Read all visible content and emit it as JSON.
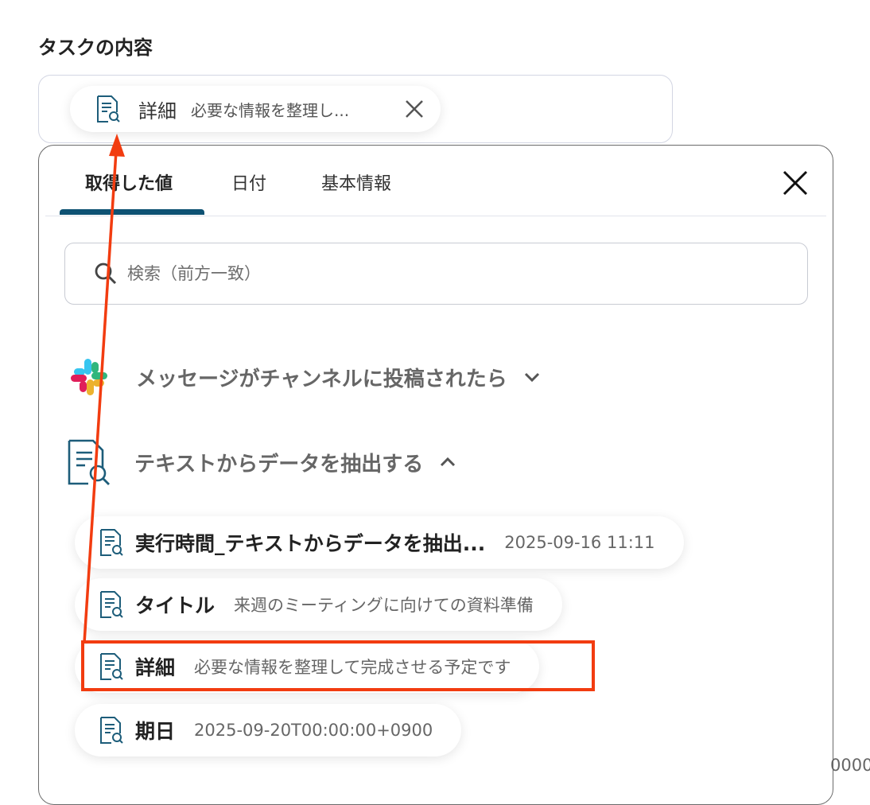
{
  "section": {
    "title": "タスクの内容"
  },
  "selected_value": {
    "label": "詳細",
    "preview": "必要な情報を整理し..."
  },
  "dropdown": {
    "tabs": [
      {
        "label": "取得した値",
        "active": true
      },
      {
        "label": "日付",
        "active": false
      },
      {
        "label": "基本情報",
        "active": false
      }
    ],
    "search": {
      "placeholder": "検索（前方一致）",
      "value": ""
    },
    "groups": [
      {
        "title": "メッセージがチャンネルに投稿されたら",
        "icon": "slack-logo-icon",
        "expanded": false
      },
      {
        "title": "テキストからデータを抽出する",
        "icon": "document-search-icon",
        "expanded": true
      }
    ],
    "items": [
      {
        "label": "実行時間_テキストからデータを抽出...",
        "value": "2025-09-16 11:11"
      },
      {
        "label": "タイトル",
        "value": "来週のミーティングに向けての資料準備"
      },
      {
        "label": "詳細",
        "value": "必要な情報を整理して完成させる予定です"
      },
      {
        "label": "期日",
        "value": "2025-09-20T00:00:00+0900"
      }
    ]
  },
  "overflow_text": "0000",
  "colors": {
    "tab_accent": "#0e5273",
    "icon_teal": "#1d5d7a",
    "annotation_red": "#f23c10"
  }
}
